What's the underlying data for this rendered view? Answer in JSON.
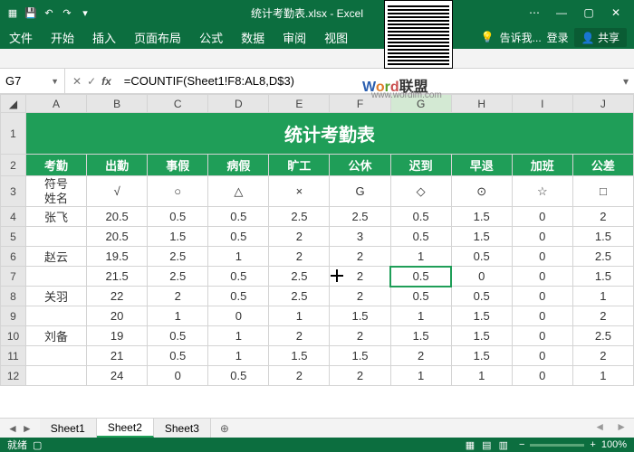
{
  "app": {
    "title": "统计考勤表.xlsx - Excel"
  },
  "tabs": [
    "文件",
    "开始",
    "插入",
    "页面布局",
    "公式",
    "数据",
    "审阅",
    "视图"
  ],
  "ribbon_right": {
    "tell": "告诉我...",
    "login": "登录",
    "share": "共享"
  },
  "formula_bar": {
    "cell_ref": "G7",
    "formula": "=COUNTIF(Sheet1!F8:AL8,D$3)"
  },
  "columns": [
    "A",
    "B",
    "C",
    "D",
    "E",
    "F",
    "G",
    "H",
    "I",
    "J"
  ],
  "title_cell": "统计考勤表",
  "header_row": [
    "考勤",
    "出勤",
    "事假",
    "病假",
    "旷工",
    "公休",
    "迟到",
    "早退",
    "加班",
    "公差"
  ],
  "symbol_label_top": "符号",
  "symbol_label_bottom": "姓名",
  "symbols": [
    "√",
    "○",
    "△",
    "×",
    "G",
    "◇",
    "⊙",
    "☆",
    "□"
  ],
  "rows": [
    {
      "n": "4",
      "name": "张飞",
      "v": [
        "20.5",
        "0.5",
        "0.5",
        "2.5",
        "2.5",
        "0.5",
        "1.5",
        "0",
        "2"
      ]
    },
    {
      "n": "5",
      "name": "",
      "v": [
        "20.5",
        "1.5",
        "0.5",
        "2",
        "3",
        "0.5",
        "1.5",
        "0",
        "1.5"
      ]
    },
    {
      "n": "6",
      "name": "赵云",
      "v": [
        "19.5",
        "2.5",
        "1",
        "2",
        "2",
        "1",
        "0.5",
        "0",
        "2.5"
      ]
    },
    {
      "n": "7",
      "name": "",
      "v": [
        "21.5",
        "2.5",
        "0.5",
        "2.5",
        "2",
        "0.5",
        "0",
        "0",
        "1.5"
      ]
    },
    {
      "n": "8",
      "name": "关羽",
      "v": [
        "22",
        "2",
        "0.5",
        "2.5",
        "2",
        "0.5",
        "0.5",
        "0",
        "1"
      ]
    },
    {
      "n": "9",
      "name": "",
      "v": [
        "20",
        "1",
        "0",
        "1",
        "1.5",
        "1",
        "1.5",
        "0",
        "2"
      ]
    },
    {
      "n": "10",
      "name": "刘备",
      "v": [
        "19",
        "0.5",
        "1",
        "2",
        "2",
        "1.5",
        "1.5",
        "0",
        "2.5"
      ]
    },
    {
      "n": "11",
      "name": "",
      "v": [
        "21",
        "0.5",
        "1",
        "1.5",
        "1.5",
        "2",
        "1.5",
        "0",
        "2"
      ]
    },
    {
      "n": "12",
      "name": "",
      "v": [
        "24",
        "0",
        "0.5",
        "2",
        "2",
        "1",
        "1",
        "0",
        "1"
      ]
    }
  ],
  "row_labels_pre": [
    "1",
    "2",
    "3"
  ],
  "sheets": {
    "list": [
      "Sheet1",
      "Sheet2",
      "Sheet3"
    ],
    "active": 1
  },
  "status": {
    "ready": "就绪",
    "zoom": "100%"
  },
  "watermark": {
    "brand_letters": [
      "W",
      "o",
      "r",
      "d"
    ],
    "brand_cn": "联盟",
    "url": "www.wordlm.com"
  }
}
